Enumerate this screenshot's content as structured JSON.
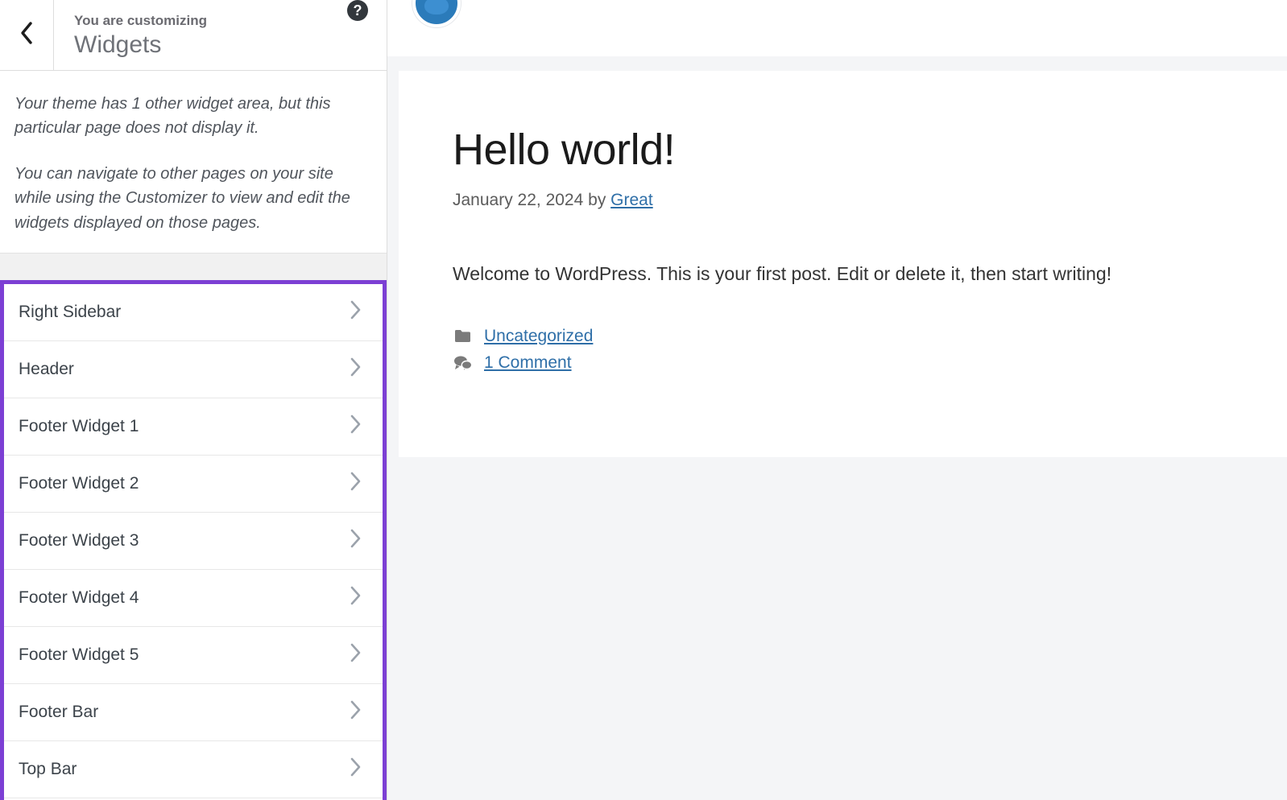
{
  "panel": {
    "back_icon": "chevron-left-icon",
    "kicker": "You are customizing",
    "title": "Widgets",
    "help_icon": "help-icon",
    "help_label": "?",
    "description": [
      "Your theme has 1 other widget area, but this particular page does not display it.",
      "You can navigate to other pages on your site while using the Customizer to view and edit the widgets displayed on those pages."
    ],
    "highlight_color": "#7c3fd4",
    "widget_areas": [
      {
        "label": "Right Sidebar",
        "chevron_icon": "chevron-right-icon"
      },
      {
        "label": "Header",
        "chevron_icon": "chevron-right-icon"
      },
      {
        "label": "Footer Widget 1",
        "chevron_icon": "chevron-right-icon"
      },
      {
        "label": "Footer Widget 2",
        "chevron_icon": "chevron-right-icon"
      },
      {
        "label": "Footer Widget 3",
        "chevron_icon": "chevron-right-icon"
      },
      {
        "label": "Footer Widget 4",
        "chevron_icon": "chevron-right-icon"
      },
      {
        "label": "Footer Widget 5",
        "chevron_icon": "chevron-right-icon"
      },
      {
        "label": "Footer Bar",
        "chevron_icon": "chevron-right-icon"
      },
      {
        "label": "Top Bar",
        "chevron_icon": "chevron-right-icon"
      }
    ]
  },
  "preview": {
    "avatar_icon": "site-avatar",
    "post": {
      "title": "Hello world!",
      "date": "January 22, 2024",
      "by_text": "by",
      "author": "Great",
      "body": "Welcome to WordPress. This is your first post. Edit or delete it, then start writing!",
      "category_icon": "folder-icon",
      "category": "Uncategorized",
      "comments_icon": "comments-icon",
      "comments": "1 Comment"
    }
  }
}
